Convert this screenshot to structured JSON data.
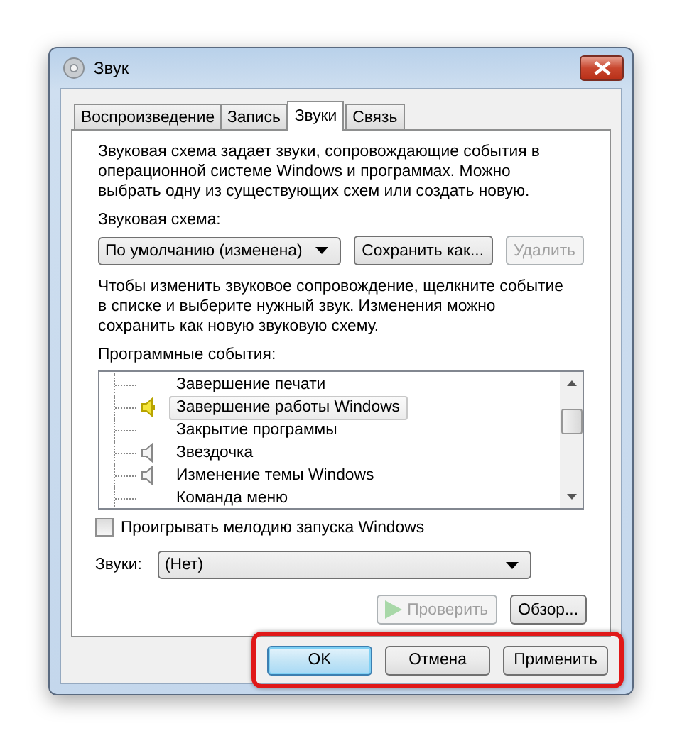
{
  "window": {
    "title": "Звук"
  },
  "tabs": [
    {
      "label": "Воспроизведение",
      "selected": false
    },
    {
      "label": "Запись",
      "selected": false
    },
    {
      "label": "Звуки",
      "selected": true
    },
    {
      "label": "Связь",
      "selected": false
    }
  ],
  "description": "Звуковая схема задает звуки, сопровождающие события в операционной системе Windows и программах. Можно выбрать одну из существующих схем или создать новую.",
  "scheme": {
    "label": "Звуковая схема:",
    "value": "По умолчанию (изменена)",
    "buttons": [
      {
        "label": "Сохранить как...",
        "disabled": false
      },
      {
        "label": "Удалить",
        "disabled": true
      }
    ]
  },
  "hint": "Чтобы изменить звуковое сопровождение, щелкните событие в списке и выберите нужный звук. Изменения можно сохранить как новую звуковую схему.",
  "events": {
    "label": "Программные события:",
    "items": [
      {
        "label": "Завершение печати",
        "kind": "none",
        "selected": false
      },
      {
        "label": "Завершение работы Windows",
        "kind": "active",
        "selected": true
      },
      {
        "label": "Закрытие программы",
        "kind": "none",
        "selected": false
      },
      {
        "label": "Звездочка",
        "kind": "sound",
        "selected": false
      },
      {
        "label": "Изменение темы Windows",
        "kind": "sound",
        "selected": false
      },
      {
        "label": "Команда меню",
        "kind": "none",
        "selected": false
      }
    ]
  },
  "startup_sound": {
    "label": "Проигрывать мелодию запуска Windows",
    "checked": false
  },
  "sounds": {
    "label": "Звуки:",
    "value": "(Нет)"
  },
  "test_button": {
    "label": "Проверить",
    "disabled": true
  },
  "browse_button": {
    "label": "Обзор...",
    "disabled": false
  },
  "dialog_buttons": [
    {
      "label": "OK",
      "default": true
    },
    {
      "label": "Отмена",
      "default": false
    },
    {
      "label": "Применить",
      "default": false
    }
  ],
  "buttons_highlighted": true
}
